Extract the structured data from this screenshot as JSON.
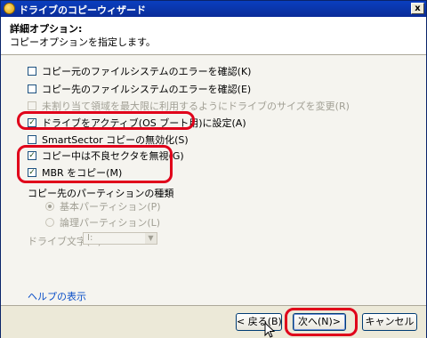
{
  "window": {
    "title": "ドライブのコピーウィザード",
    "close_label": "x"
  },
  "header": {
    "title": "詳細オプション:",
    "subtitle": "コピーオプションを指定します。"
  },
  "options": [
    {
      "label": "コピー元のファイルシステムのエラーを確認(K)",
      "checked": false,
      "enabled": true
    },
    {
      "label": "コピー先のファイルシステムのエラーを確認(E)",
      "checked": false,
      "enabled": true
    },
    {
      "label": "未割り当て領域を最大限に利用するようにドライブのサイズを変更(R)",
      "checked": false,
      "enabled": false
    },
    {
      "label": "ドライブをアクティブ(OS ブート用)に設定(A)",
      "checked": true,
      "enabled": true
    },
    {
      "label": "SmartSector コピーの無効化(S)",
      "checked": false,
      "enabled": true
    },
    {
      "label": "コピー中は不良セクタを無視(G)",
      "checked": true,
      "enabled": true
    },
    {
      "label": "MBR をコピー(M)",
      "checked": true,
      "enabled": true
    }
  ],
  "partition_type": {
    "label": "コピー先のパーティションの種類",
    "primary_label": "基本パーティション(P)",
    "logical_label": "論理パーティション(L)",
    "selected": "primary"
  },
  "drive_letter": {
    "label": "ドライブ文字(D)",
    "value": "I:"
  },
  "help_link": "ヘルプの表示",
  "buttons": {
    "back": "< 戻る(B)",
    "next": "次へ(N)>",
    "cancel": "キャンセル"
  },
  "colors": {
    "highlight_box": "#e0001a",
    "title_bar": "#0a3fbf"
  }
}
